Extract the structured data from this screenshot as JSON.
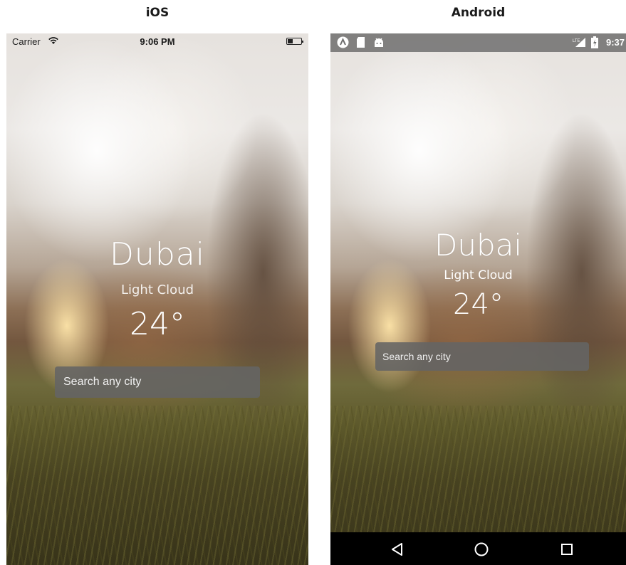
{
  "labels": {
    "ios": "iOS",
    "android": "Android"
  },
  "ios": {
    "status": {
      "carrier": "Carrier",
      "time": "9:06 PM"
    },
    "weather": {
      "city": "Dubai",
      "condition": "Light Cloud",
      "temperature": "24°"
    },
    "search": {
      "placeholder": "Search any city",
      "value": ""
    }
  },
  "android": {
    "status": {
      "time": "9:37",
      "network": "LTE"
    },
    "weather": {
      "city": "Dubai",
      "condition": "Light Cloud",
      "temperature": "24°"
    },
    "search": {
      "placeholder": "Search any city",
      "value": ""
    }
  },
  "icons": {
    "ios_status": [
      "wifi-icon",
      "battery-icon"
    ],
    "android_status": [
      "app-a-icon",
      "sd-card-icon",
      "android-icon",
      "lte-signal-icon",
      "battery-charging-icon"
    ],
    "android_nav": [
      "back-icon",
      "home-icon",
      "recents-icon"
    ]
  }
}
